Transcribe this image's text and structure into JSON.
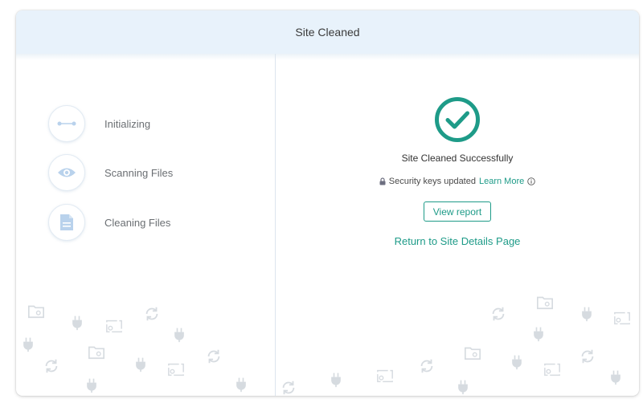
{
  "header": {
    "title": "Site Cleaned"
  },
  "steps": [
    {
      "label": "Initializing",
      "icon": "connector-icon"
    },
    {
      "label": "Scanning Files",
      "icon": "eye-icon"
    },
    {
      "label": "Cleaning Files",
      "icon": "document-icon"
    }
  ],
  "result": {
    "title": "Site Cleaned Successfully",
    "keys_text": "Security keys updated",
    "learn_more": "Learn More",
    "view_report": "View report",
    "return_link": "Return to Site Details Page"
  },
  "colors": {
    "accent": "#1e9b88",
    "header_bg": "#e8f2fb",
    "step_icon": "#b9d2ec",
    "decor_icon": "#dfe3e7"
  }
}
